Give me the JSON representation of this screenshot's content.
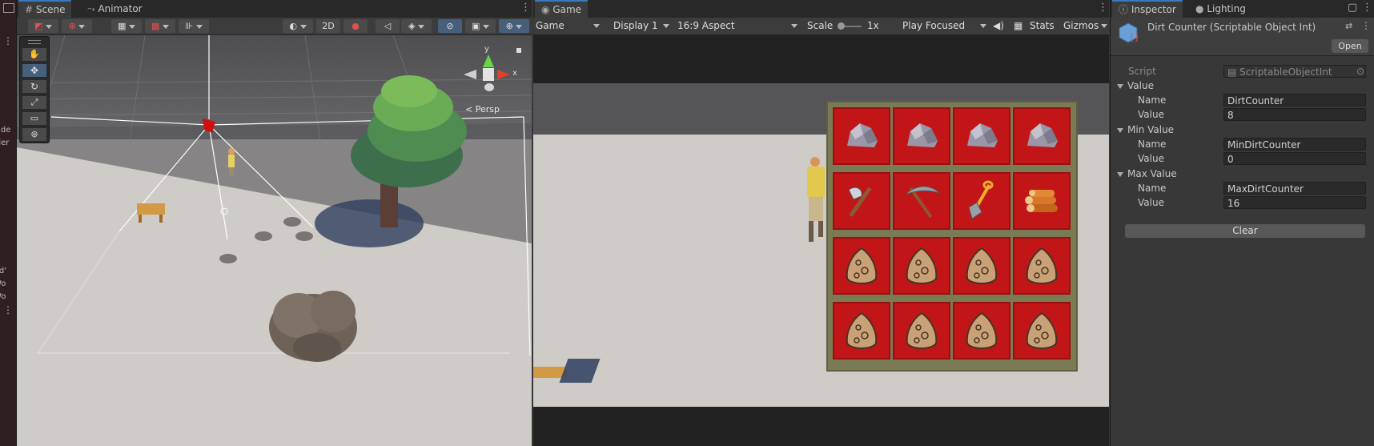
{
  "scene_panel": {
    "tabs": [
      {
        "label": "Scene"
      },
      {
        "label": "Animator"
      }
    ],
    "toolbar": {
      "two_d_label": "2D"
    },
    "gizmo": {
      "y_label": "y",
      "x_label": "x",
      "persp_label": "Persp"
    }
  },
  "left_strip": {
    "fragments": [
      "olde",
      "lder",
      "rld'",
      "Wo",
      "Wo"
    ]
  },
  "game_panel": {
    "tab_label": "Game",
    "toolbar": {
      "view_select": "Game",
      "display_select": "Display 1",
      "aspect_select": "16:9 Aspect",
      "scale_label": "Scale",
      "scale_value": "1x",
      "play_mode_select": "Play Focused",
      "stats_label": "Stats",
      "gizmos_label": "Gizmos"
    },
    "inventory": {
      "rows": [
        [
          "rock",
          "rock",
          "rock",
          "rock"
        ],
        [
          "axe",
          "pickaxe",
          "shovel",
          "logs"
        ],
        [
          "dirt",
          "dirt",
          "dirt",
          "dirt"
        ],
        [
          "dirt",
          "dirt",
          "dirt",
          "dirt"
        ]
      ]
    }
  },
  "inspector": {
    "tabs": [
      {
        "label": "Inspector"
      },
      {
        "label": "Lighting"
      }
    ],
    "object_title": "Dirt Counter (Scriptable Object Int)",
    "open_button": "Open",
    "script_label": "Script",
    "script_value": "ScriptableObjectInt",
    "groups": [
      {
        "title": "Value",
        "name_label": "Name",
        "name_value": "DirtCounter",
        "value_label": "Value",
        "value_value": "8"
      },
      {
        "title": "Min Value",
        "name_label": "Name",
        "name_value": "MinDirtCounter",
        "value_label": "Value",
        "value_value": "0"
      },
      {
        "title": "Max Value",
        "name_label": "Name",
        "name_value": "MaxDirtCounter",
        "value_label": "Value",
        "value_value": "16"
      }
    ],
    "clear_button": "Clear"
  },
  "colors": {
    "tab_accent": "#3a79bb",
    "slot_red": "#c21517",
    "inventory_frame": "#7a7a55",
    "ground": "#cfcbc7"
  }
}
